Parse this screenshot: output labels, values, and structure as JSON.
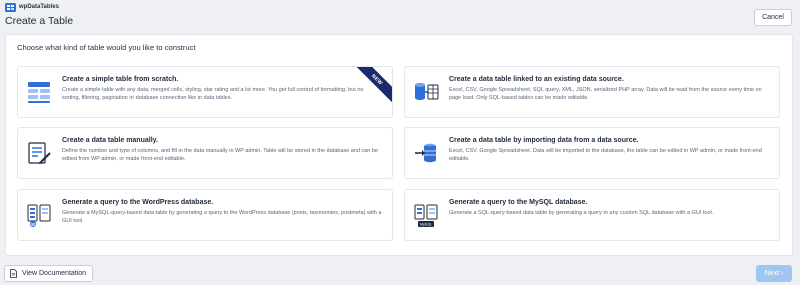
{
  "app": {
    "logo_text": "wpDataTables"
  },
  "header": {
    "title": "Create a Table",
    "cancel_label": "Cancel"
  },
  "panel": {
    "heading": "Choose what kind of table would you like to construct"
  },
  "cards": [
    {
      "title": "Create a simple table from scratch.",
      "description": "Create a simple table with any data, merged cells, styling, star rating and a lot more. You get full control of formatting, but no sorting, filtering, pagination or database connection like in data tables.",
      "badge": "NEW",
      "icon": "simple-table-icon"
    },
    {
      "title": "Create a data table linked to an existing data source.",
      "description": "Excel, CSV, Google Spreadsheet, SQL query, XML, JSON, serialized PHP array. Data will be read from the source every time on page load. Only SQL-based tables can be made editable.",
      "icon": "linked-data-source-icon"
    },
    {
      "title": "Create a data table manually.",
      "description": "Define the number and type of columns, and fill in the data manually in WP admin. Table will be stored in the database and can be edited from WP admin, or made front-end editable.",
      "icon": "manual-table-icon"
    },
    {
      "title": "Create a data table by importing data from a data source.",
      "description": "Excel, CSV, Google Spreadsheet. Data will be imported to the database, the table can be edited in WP admin, or made front-end editable.",
      "icon": "import-data-icon"
    },
    {
      "title": "Generate a query to the WordPress database.",
      "description": "Generate a MySQL-query-based data table by generating a query to the WordPress database (posts, taxonomies, postmeta) with a GUI tool.",
      "icon": "wordpress-query-icon"
    },
    {
      "title": "Generate a query to the MySQL database.",
      "description": "Generate a SQL-query-based data table by generating a query to any custom SQL database with a GUI tool.",
      "icon": "mysql-query-icon",
      "icon_label": "MySQL"
    }
  ],
  "footer": {
    "documentation_label": "View Documentation",
    "next_label": "Next",
    "next_arrow": "›"
  },
  "colors": {
    "accent": "#2f6fd6",
    "ribbon": "#1a2b6d",
    "next_disabled": "#9fc6f2",
    "background": "#eef0f4"
  }
}
